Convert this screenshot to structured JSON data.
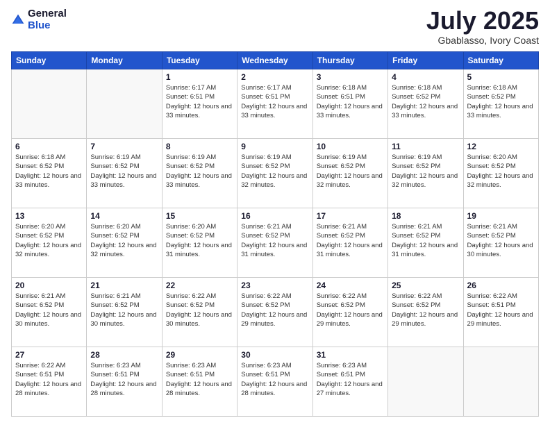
{
  "header": {
    "logo_general": "General",
    "logo_blue": "Blue",
    "month_title": "July 2025",
    "location": "Gbablasso, Ivory Coast"
  },
  "days_of_week": [
    "Sunday",
    "Monday",
    "Tuesday",
    "Wednesday",
    "Thursday",
    "Friday",
    "Saturday"
  ],
  "weeks": [
    [
      {
        "day": "",
        "empty": true
      },
      {
        "day": "",
        "empty": true
      },
      {
        "day": "1",
        "sunrise": "Sunrise: 6:17 AM",
        "sunset": "Sunset: 6:51 PM",
        "daylight": "Daylight: 12 hours and 33 minutes."
      },
      {
        "day": "2",
        "sunrise": "Sunrise: 6:17 AM",
        "sunset": "Sunset: 6:51 PM",
        "daylight": "Daylight: 12 hours and 33 minutes."
      },
      {
        "day": "3",
        "sunrise": "Sunrise: 6:18 AM",
        "sunset": "Sunset: 6:51 PM",
        "daylight": "Daylight: 12 hours and 33 minutes."
      },
      {
        "day": "4",
        "sunrise": "Sunrise: 6:18 AM",
        "sunset": "Sunset: 6:52 PM",
        "daylight": "Daylight: 12 hours and 33 minutes."
      },
      {
        "day": "5",
        "sunrise": "Sunrise: 6:18 AM",
        "sunset": "Sunset: 6:52 PM",
        "daylight": "Daylight: 12 hours and 33 minutes."
      }
    ],
    [
      {
        "day": "6",
        "sunrise": "Sunrise: 6:18 AM",
        "sunset": "Sunset: 6:52 PM",
        "daylight": "Daylight: 12 hours and 33 minutes."
      },
      {
        "day": "7",
        "sunrise": "Sunrise: 6:19 AM",
        "sunset": "Sunset: 6:52 PM",
        "daylight": "Daylight: 12 hours and 33 minutes."
      },
      {
        "day": "8",
        "sunrise": "Sunrise: 6:19 AM",
        "sunset": "Sunset: 6:52 PM",
        "daylight": "Daylight: 12 hours and 33 minutes."
      },
      {
        "day": "9",
        "sunrise": "Sunrise: 6:19 AM",
        "sunset": "Sunset: 6:52 PM",
        "daylight": "Daylight: 12 hours and 32 minutes."
      },
      {
        "day": "10",
        "sunrise": "Sunrise: 6:19 AM",
        "sunset": "Sunset: 6:52 PM",
        "daylight": "Daylight: 12 hours and 32 minutes."
      },
      {
        "day": "11",
        "sunrise": "Sunrise: 6:19 AM",
        "sunset": "Sunset: 6:52 PM",
        "daylight": "Daylight: 12 hours and 32 minutes."
      },
      {
        "day": "12",
        "sunrise": "Sunrise: 6:20 AM",
        "sunset": "Sunset: 6:52 PM",
        "daylight": "Daylight: 12 hours and 32 minutes."
      }
    ],
    [
      {
        "day": "13",
        "sunrise": "Sunrise: 6:20 AM",
        "sunset": "Sunset: 6:52 PM",
        "daylight": "Daylight: 12 hours and 32 minutes."
      },
      {
        "day": "14",
        "sunrise": "Sunrise: 6:20 AM",
        "sunset": "Sunset: 6:52 PM",
        "daylight": "Daylight: 12 hours and 32 minutes."
      },
      {
        "day": "15",
        "sunrise": "Sunrise: 6:20 AM",
        "sunset": "Sunset: 6:52 PM",
        "daylight": "Daylight: 12 hours and 31 minutes."
      },
      {
        "day": "16",
        "sunrise": "Sunrise: 6:21 AM",
        "sunset": "Sunset: 6:52 PM",
        "daylight": "Daylight: 12 hours and 31 minutes."
      },
      {
        "day": "17",
        "sunrise": "Sunrise: 6:21 AM",
        "sunset": "Sunset: 6:52 PM",
        "daylight": "Daylight: 12 hours and 31 minutes."
      },
      {
        "day": "18",
        "sunrise": "Sunrise: 6:21 AM",
        "sunset": "Sunset: 6:52 PM",
        "daylight": "Daylight: 12 hours and 31 minutes."
      },
      {
        "day": "19",
        "sunrise": "Sunrise: 6:21 AM",
        "sunset": "Sunset: 6:52 PM",
        "daylight": "Daylight: 12 hours and 30 minutes."
      }
    ],
    [
      {
        "day": "20",
        "sunrise": "Sunrise: 6:21 AM",
        "sunset": "Sunset: 6:52 PM",
        "daylight": "Daylight: 12 hours and 30 minutes."
      },
      {
        "day": "21",
        "sunrise": "Sunrise: 6:21 AM",
        "sunset": "Sunset: 6:52 PM",
        "daylight": "Daylight: 12 hours and 30 minutes."
      },
      {
        "day": "22",
        "sunrise": "Sunrise: 6:22 AM",
        "sunset": "Sunset: 6:52 PM",
        "daylight": "Daylight: 12 hours and 30 minutes."
      },
      {
        "day": "23",
        "sunrise": "Sunrise: 6:22 AM",
        "sunset": "Sunset: 6:52 PM",
        "daylight": "Daylight: 12 hours and 29 minutes."
      },
      {
        "day": "24",
        "sunrise": "Sunrise: 6:22 AM",
        "sunset": "Sunset: 6:52 PM",
        "daylight": "Daylight: 12 hours and 29 minutes."
      },
      {
        "day": "25",
        "sunrise": "Sunrise: 6:22 AM",
        "sunset": "Sunset: 6:52 PM",
        "daylight": "Daylight: 12 hours and 29 minutes."
      },
      {
        "day": "26",
        "sunrise": "Sunrise: 6:22 AM",
        "sunset": "Sunset: 6:51 PM",
        "daylight": "Daylight: 12 hours and 29 minutes."
      }
    ],
    [
      {
        "day": "27",
        "sunrise": "Sunrise: 6:22 AM",
        "sunset": "Sunset: 6:51 PM",
        "daylight": "Daylight: 12 hours and 28 minutes."
      },
      {
        "day": "28",
        "sunrise": "Sunrise: 6:23 AM",
        "sunset": "Sunset: 6:51 PM",
        "daylight": "Daylight: 12 hours and 28 minutes."
      },
      {
        "day": "29",
        "sunrise": "Sunrise: 6:23 AM",
        "sunset": "Sunset: 6:51 PM",
        "daylight": "Daylight: 12 hours and 28 minutes."
      },
      {
        "day": "30",
        "sunrise": "Sunrise: 6:23 AM",
        "sunset": "Sunset: 6:51 PM",
        "daylight": "Daylight: 12 hours and 28 minutes."
      },
      {
        "day": "31",
        "sunrise": "Sunrise: 6:23 AM",
        "sunset": "Sunset: 6:51 PM",
        "daylight": "Daylight: 12 hours and 27 minutes."
      },
      {
        "day": "",
        "empty": true
      },
      {
        "day": "",
        "empty": true
      }
    ]
  ]
}
